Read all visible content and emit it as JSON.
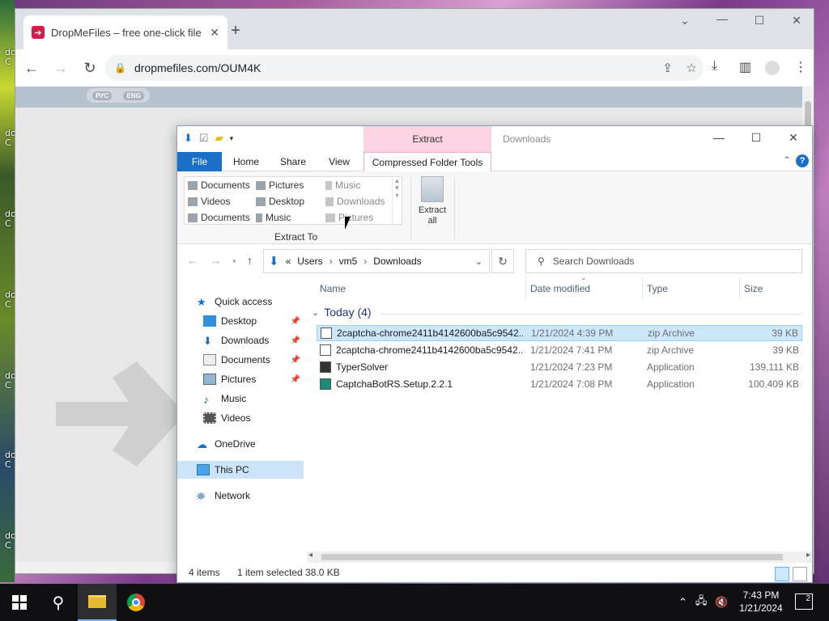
{
  "browser": {
    "tab_title": "DropMeFiles – free one-click file",
    "url": "dropmefiles.com/OUM4K",
    "lang": {
      "a": "РУС",
      "b": "ENG"
    }
  },
  "explorer": {
    "context_tab": "Extract",
    "window_title": "Downloads",
    "ribbon_tabs": {
      "file": "File",
      "home": "Home",
      "share": "Share",
      "view": "View",
      "cft": "Compressed Folder Tools"
    },
    "gallery": [
      [
        "Documents",
        "Pictures",
        "Music"
      ],
      [
        "Videos",
        "Desktop",
        "Downloads"
      ],
      [
        "Documents",
        "Music",
        "Pictures"
      ]
    ],
    "extract_to": "Extract To",
    "extract_all": "Extract all",
    "breadcrumb": {
      "chev": "«",
      "p1": "Users",
      "p2": "vm5",
      "p3": "Downloads"
    },
    "search_placeholder": "Search Downloads",
    "nav": {
      "quick_access": "Quick access",
      "desktop": "Desktop",
      "downloads": "Downloads",
      "documents": "Documents",
      "pictures": "Pictures",
      "music": "Music",
      "videos": "Videos",
      "onedrive": "OneDrive",
      "thispc": "This PC",
      "network": "Network"
    },
    "columns": {
      "name": "Name",
      "date": "Date modified",
      "type": "Type",
      "size": "Size"
    },
    "group": "Today (4)",
    "files": [
      {
        "name": "2captcha-chrome2411b4142600ba5c9542...",
        "date": "1/21/2024 4:39 PM",
        "type": "zip Archive",
        "size": "39 KB"
      },
      {
        "name": "2captcha-chrome2411b4142600ba5c9542...",
        "date": "1/21/2024 7:41 PM",
        "type": "zip Archive",
        "size": "39 KB"
      },
      {
        "name": "TyperSolver",
        "date": "1/21/2024 7:23 PM",
        "type": "Application",
        "size": "139,111 KB"
      },
      {
        "name": "CaptchaBotRS.Setup.2.2.1",
        "date": "1/21/2024 7:08 PM",
        "type": "Application",
        "size": "100,409 KB"
      }
    ],
    "status": {
      "count": "4 items",
      "selected": "1 item selected  38.0 KB"
    }
  },
  "taskbar": {
    "time": "7:43 PM",
    "date": "1/21/2024",
    "notifications": "2"
  },
  "desktop_labels": [
    "do",
    "C",
    "do",
    "C",
    "do",
    "C",
    "do",
    "C",
    "do",
    "C",
    "do",
    "C",
    "do",
    "C"
  ]
}
